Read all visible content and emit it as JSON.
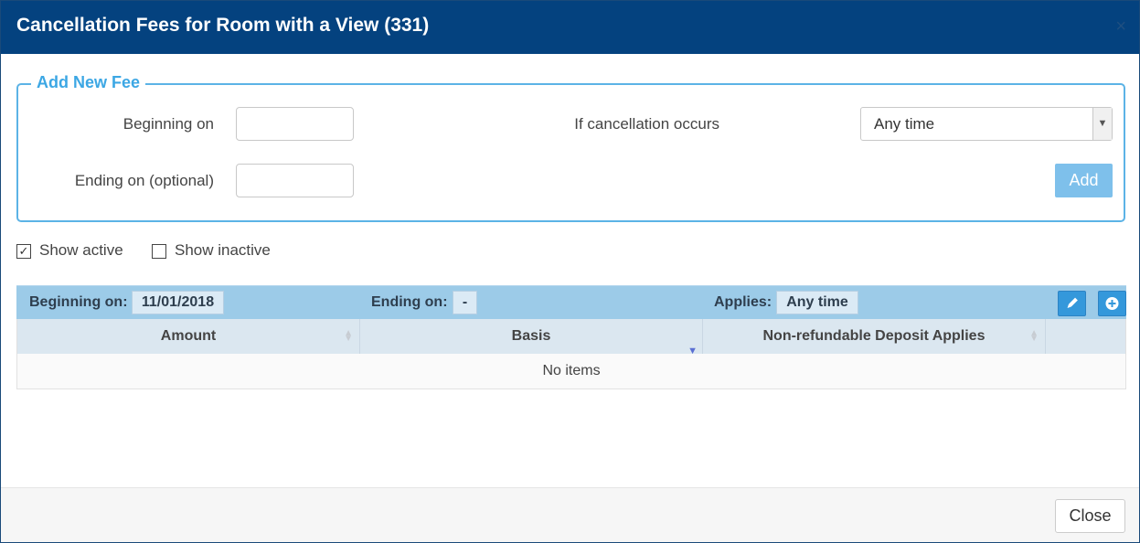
{
  "modal": {
    "title": "Cancellation Fees for Room with a View (331)",
    "close_icon": "×"
  },
  "form": {
    "legend": "Add New Fee",
    "beginning_label": "Beginning on",
    "beginning_value": "",
    "ending_label": "Ending on (optional)",
    "ending_value": "",
    "cancellation_label": "If cancellation occurs",
    "cancellation_selected": "Any time",
    "add_label": "Add"
  },
  "filters": {
    "show_active_label": "Show active",
    "show_active_checked": true,
    "show_inactive_label": "Show inactive",
    "show_inactive_checked": false
  },
  "group": {
    "beginning_label": "Beginning on:",
    "beginning_value": "11/01/2018",
    "ending_label": "Ending on:",
    "ending_value": "-",
    "applies_label": "Applies:",
    "applies_value": "Any time",
    "edit_icon": "pencil-icon",
    "add_icon": "plus-circle-icon"
  },
  "table": {
    "columns": [
      "Amount",
      "Basis",
      "Non-refundable Deposit Applies"
    ],
    "empty_text": "No items"
  },
  "footer": {
    "close_label": "Close"
  },
  "colors": {
    "header": "#04427f",
    "accent": "#3ca7e4",
    "group_bar": "#9ccbe8",
    "icon_button": "#3498db"
  }
}
